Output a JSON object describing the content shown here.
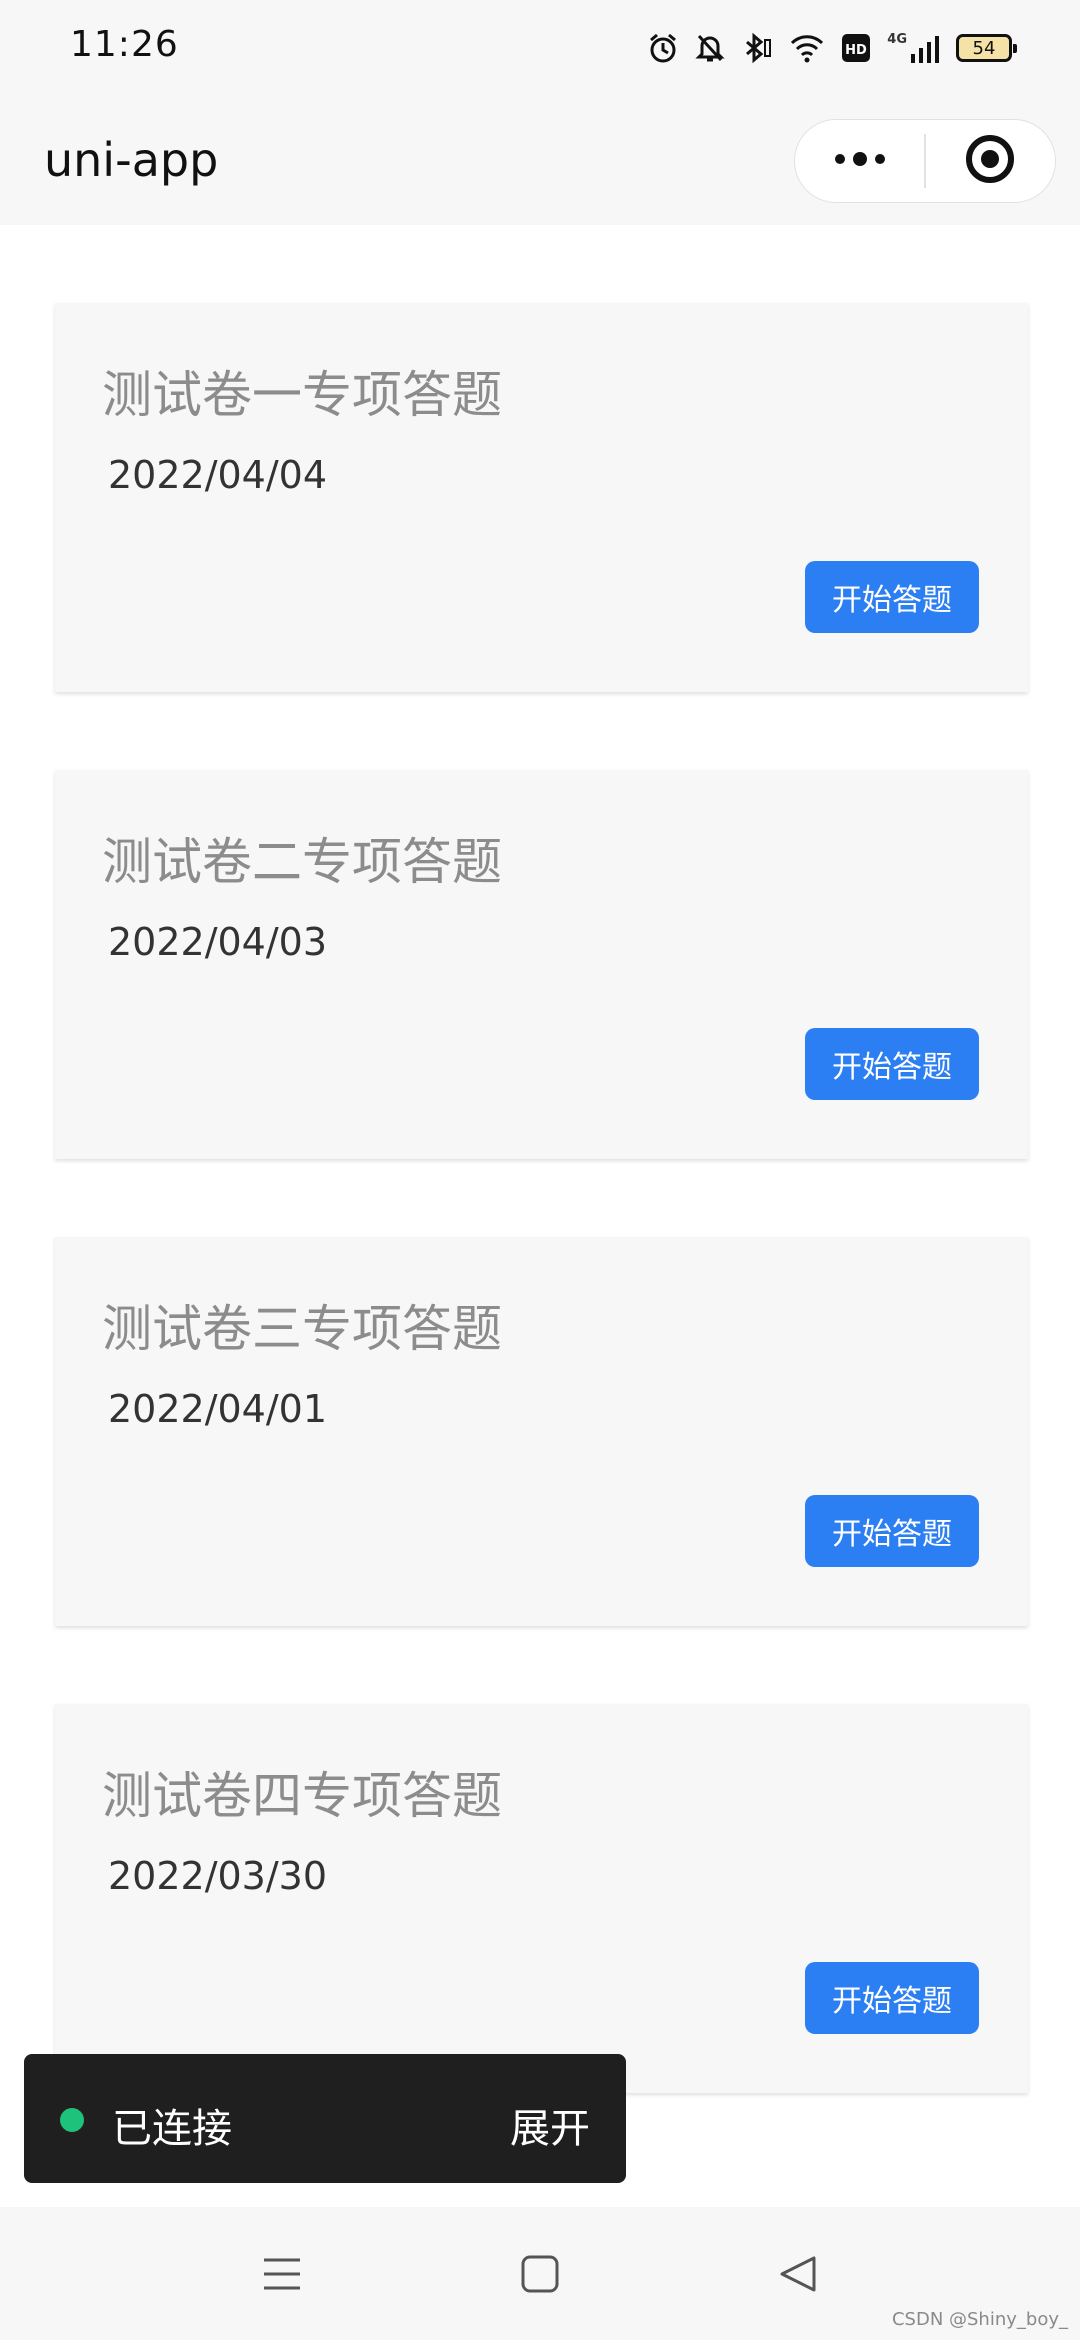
{
  "status_bar": {
    "time": "11:26",
    "network": "4G",
    "battery": "54",
    "icons": [
      "alarm-icon",
      "mute-icon",
      "bluetooth-icon",
      "wifi-icon",
      "hd-icon",
      "signal-icon",
      "battery-icon"
    ]
  },
  "nav": {
    "title": "uni-app",
    "menu_icon": "more-dots-icon",
    "close_icon": "target-circle-icon"
  },
  "cards": [
    {
      "title": "测试卷一专项答题",
      "date": "2022/04/04",
      "button": "开始答题"
    },
    {
      "title": "测试卷二专项答题",
      "date": "2022/04/03",
      "button": "开始答题"
    },
    {
      "title": "测试卷三专项答题",
      "date": "2022/04/01",
      "button": "开始答题"
    },
    {
      "title": "测试卷四专项答题",
      "date": "2022/03/30",
      "button": "开始答题"
    }
  ],
  "connection": {
    "status": "已连接",
    "expand": "展开",
    "status_color": "#1ec27a"
  },
  "colors": {
    "accent": "#2b7ff3",
    "card_bg": "#f7f7f8",
    "title_gray": "#8c8c8c"
  },
  "system_nav": {
    "icons": [
      "menu-icon",
      "home-square-icon",
      "back-triangle-icon"
    ]
  },
  "watermark": "CSDN @Shiny_boy_"
}
